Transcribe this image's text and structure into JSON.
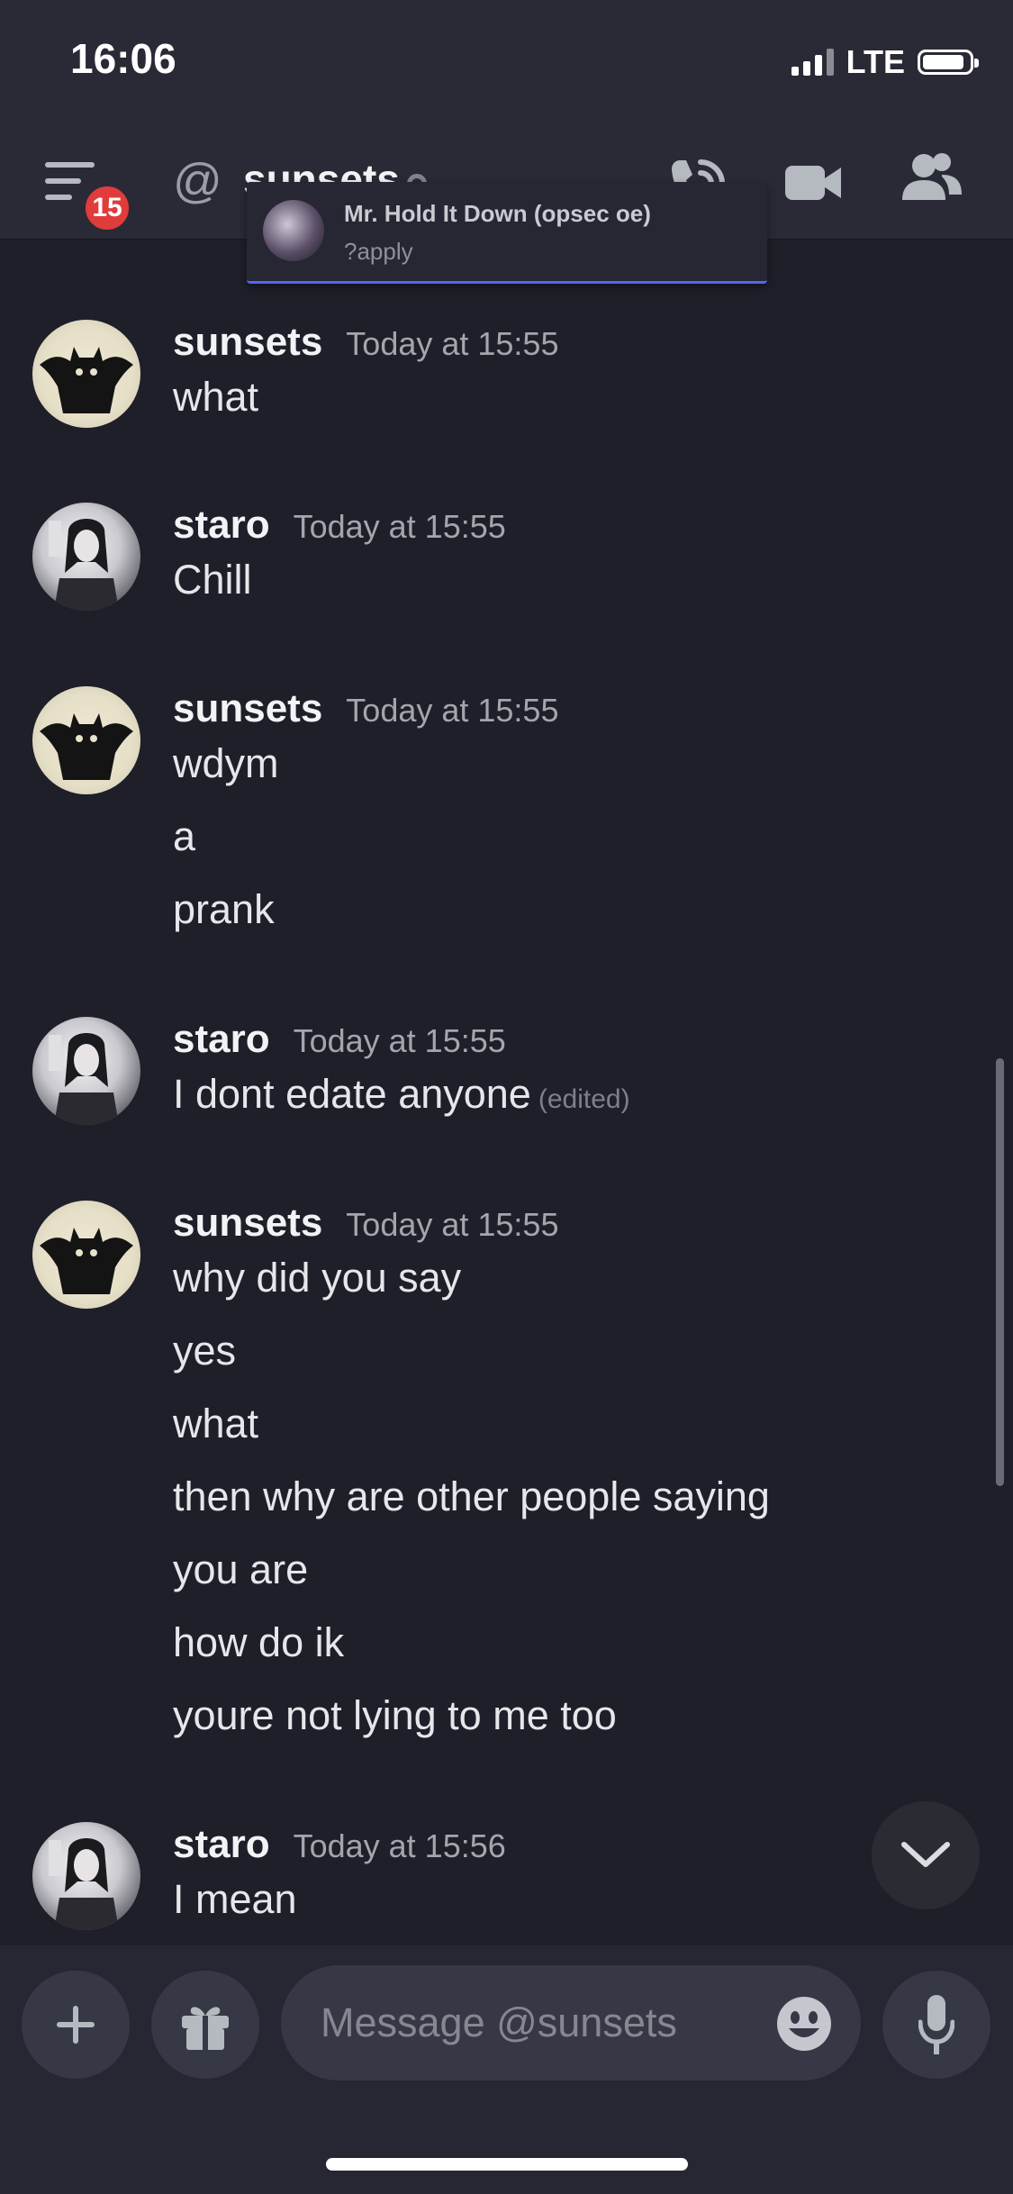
{
  "status_bar": {
    "time": "16:06",
    "network": "LTE"
  },
  "header": {
    "badge_count": "15",
    "title": "sunsets"
  },
  "popup": {
    "name": "Mr. Hold It Down (opsec oe)",
    "command": "?apply"
  },
  "messages": [
    {
      "author": "sunsets",
      "time": "Today at 15:55",
      "lines": [
        "what"
      ]
    },
    {
      "author": "staro",
      "time": "Today at 15:55",
      "lines": [
        "Chill"
      ]
    },
    {
      "author": "sunsets",
      "time": "Today at 15:55",
      "lines": [
        "wdym",
        "a",
        "prank"
      ]
    },
    {
      "author": "staro",
      "time": "Today at 15:55",
      "lines": [
        "I dont edate anyone"
      ],
      "edited_label": "(edited)"
    },
    {
      "author": "sunsets",
      "time": "Today at 15:55",
      "lines": [
        "why did you say",
        "yes",
        "what",
        "then why are other people saying",
        "you are",
        "how do ik",
        "youre not lying to me too"
      ]
    },
    {
      "author": "staro",
      "time": "Today at 15:56",
      "lines": [
        "I mean"
      ]
    }
  ],
  "composer": {
    "placeholder": "Message @sunsets"
  }
}
